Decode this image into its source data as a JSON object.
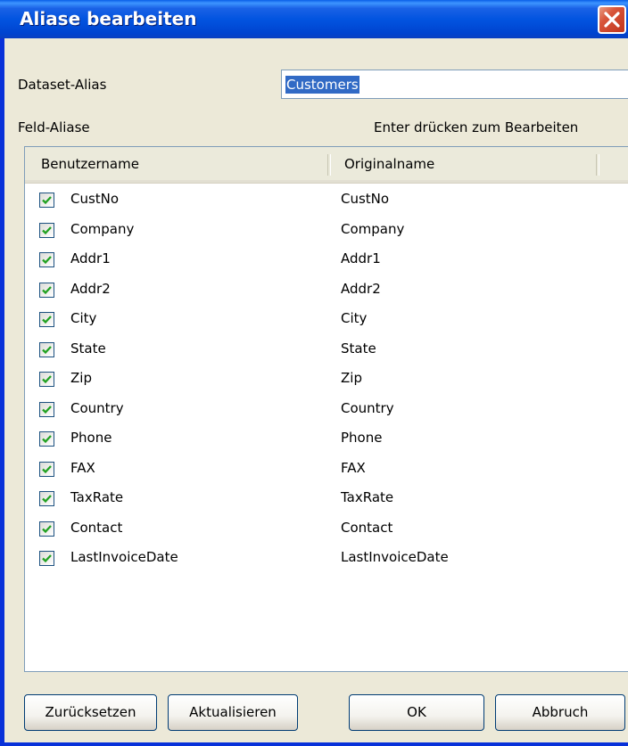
{
  "window": {
    "title": "Aliase bearbeiten"
  },
  "dataset": {
    "label": "Dataset-Alias",
    "value": "Customers"
  },
  "fields": {
    "label": "Feld-Aliase",
    "hint": "Enter drücken zum Bearbeiten"
  },
  "columns": {
    "user": "Benutzername",
    "original": "Originalname"
  },
  "rows": [
    {
      "user": "CustNo",
      "original": "CustNo",
      "checked": true
    },
    {
      "user": "Company",
      "original": "Company",
      "checked": true
    },
    {
      "user": "Addr1",
      "original": "Addr1",
      "checked": true
    },
    {
      "user": "Addr2",
      "original": "Addr2",
      "checked": true
    },
    {
      "user": "City",
      "original": "City",
      "checked": true
    },
    {
      "user": "State",
      "original": "State",
      "checked": true
    },
    {
      "user": "Zip",
      "original": "Zip",
      "checked": true
    },
    {
      "user": "Country",
      "original": "Country",
      "checked": true
    },
    {
      "user": "Phone",
      "original": "Phone",
      "checked": true
    },
    {
      "user": "FAX",
      "original": "FAX",
      "checked": true
    },
    {
      "user": "TaxRate",
      "original": "TaxRate",
      "checked": true
    },
    {
      "user": "Contact",
      "original": "Contact",
      "checked": true
    },
    {
      "user": "LastInvoiceDate",
      "original": "LastInvoiceDate",
      "checked": true
    }
  ],
  "buttons": {
    "reset": "Zurücksetzen",
    "update": "Aktualisieren",
    "ok": "OK",
    "cancel": "Abbruch"
  },
  "colors": {
    "titlebar": "#0054e3",
    "selection": "#316ac5",
    "check": "#21a121",
    "close": "#d8553a"
  }
}
